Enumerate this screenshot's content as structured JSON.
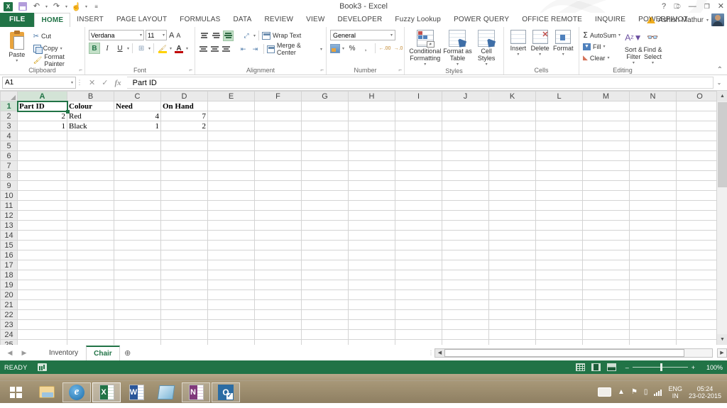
{
  "window": {
    "title": "Book3 - Excel",
    "help_icon": "?",
    "ribbon_display_icon": "ribbon-display-options",
    "minimize_icon": "—",
    "restore_icon": "❐",
    "close_icon": "✕"
  },
  "quick_access": {
    "items": [
      {
        "name": "excel-app-icon",
        "label": "X"
      },
      {
        "name": "save-icon",
        "label": ""
      },
      {
        "name": "undo-icon",
        "label": "↶"
      },
      {
        "name": "redo-icon",
        "label": "↷"
      },
      {
        "name": "touch-mode-icon",
        "label": "☝"
      },
      {
        "name": "customize-qat-icon",
        "label": "☰"
      }
    ]
  },
  "account": {
    "warning_icon": "warning-triangle-icon",
    "user_name": "Ashish Mathur",
    "dropdown": "▾"
  },
  "tabs": [
    {
      "label": "FILE",
      "active": false,
      "file": true
    },
    {
      "label": "HOME",
      "active": true
    },
    {
      "label": "INSERT",
      "active": false
    },
    {
      "label": "PAGE LAYOUT",
      "active": false
    },
    {
      "label": "FORMULAS",
      "active": false
    },
    {
      "label": "DATA",
      "active": false
    },
    {
      "label": "REVIEW",
      "active": false
    },
    {
      "label": "VIEW",
      "active": false
    },
    {
      "label": "DEVELOPER",
      "active": false
    },
    {
      "label": "Fuzzy Lookup",
      "active": false
    },
    {
      "label": "POWER QUERY",
      "active": false
    },
    {
      "label": "OFFICE REMOTE",
      "active": false
    },
    {
      "label": "INQUIRE",
      "active": false
    },
    {
      "label": "POWERPIVOT",
      "active": false
    }
  ],
  "ribbon": {
    "collapse_icon": "⌃",
    "clipboard": {
      "label": "Clipboard",
      "paste": "Paste",
      "cut": "Cut",
      "copy": "Copy",
      "format_painter": "Format Painter",
      "dialog_launcher": "⤵"
    },
    "font": {
      "label": "Font",
      "font_name": "Verdana",
      "font_size": "11",
      "grow_font": "A",
      "shrink_font": "A",
      "bold": "B",
      "italic": "I",
      "underline": "U",
      "borders": "⊞",
      "fill_color": "⬛",
      "font_color": "A",
      "dialog_launcher": "⤵"
    },
    "alignment": {
      "label": "Alignment",
      "wrap_text": "Wrap Text",
      "merge_center": "Merge & Center",
      "dialog_launcher": "⤵"
    },
    "number": {
      "label": "Number",
      "format": "General",
      "percent": "%",
      "comma": ",",
      "increase_decimal": ".00",
      "decrease_decimal": ".00",
      "dialog_launcher": "⤵"
    },
    "styles": {
      "label": "Styles",
      "conditional_formatting": "Conditional Formatting",
      "format_as_table": "Format as Table",
      "cell_styles": "Cell Styles"
    },
    "cells": {
      "label": "Cells",
      "insert": "Insert",
      "delete": "Delete",
      "format": "Format"
    },
    "editing": {
      "label": "Editing",
      "autosum": "AutoSum",
      "fill": "Fill",
      "clear": "Clear",
      "sort_filter": "Sort & Filter",
      "find_select": "Find & Select"
    }
  },
  "formula_bar": {
    "name_box": "A1",
    "name_box_caret": "▾",
    "cancel_icon": "✕",
    "enter_icon": "✓",
    "function_icon": "fx",
    "value": "Part ID",
    "expand_icon": "⌄"
  },
  "grid": {
    "columns": [
      "A",
      "B",
      "C",
      "D",
      "E",
      "F",
      "G",
      "H",
      "I",
      "J",
      "K",
      "L",
      "M",
      "N",
      "O"
    ],
    "rows": [
      1,
      2,
      3,
      4,
      5,
      6,
      7,
      8,
      9,
      10,
      11,
      12,
      13,
      14,
      15,
      16,
      17,
      18,
      19,
      20,
      21,
      22,
      23,
      24,
      25
    ],
    "selected_cell": "A1",
    "data": [
      {
        "row": 1,
        "cells": [
          {
            "col": "A",
            "value": "Part ID",
            "bold": true,
            "align": "left"
          },
          {
            "col": "B",
            "value": "Colour",
            "bold": true,
            "align": "left"
          },
          {
            "col": "C",
            "value": "Need",
            "bold": true,
            "align": "left"
          },
          {
            "col": "D",
            "value": "On Hand",
            "bold": true,
            "align": "left"
          }
        ]
      },
      {
        "row": 2,
        "cells": [
          {
            "col": "A",
            "value": "2",
            "bold": false,
            "align": "right"
          },
          {
            "col": "B",
            "value": "Red",
            "bold": false,
            "align": "left"
          },
          {
            "col": "C",
            "value": "4",
            "bold": false,
            "align": "right"
          },
          {
            "col": "D",
            "value": "7",
            "bold": false,
            "align": "right"
          }
        ]
      },
      {
        "row": 3,
        "cells": [
          {
            "col": "A",
            "value": "1",
            "bold": false,
            "align": "right"
          },
          {
            "col": "B",
            "value": "Black",
            "bold": false,
            "align": "left"
          },
          {
            "col": "C",
            "value": "1",
            "bold": false,
            "align": "right"
          },
          {
            "col": "D",
            "value": "2",
            "bold": false,
            "align": "right"
          }
        ]
      }
    ]
  },
  "sheet_tabs": {
    "first_icon": "◀",
    "last_icon": "▶",
    "sheets": [
      {
        "label": "Inventory",
        "active": false
      },
      {
        "label": "Chair",
        "active": true
      }
    ],
    "add_sheet": "⊕"
  },
  "status_bar": {
    "state": "READY",
    "macro_icon": "record-macro-icon",
    "views": [
      {
        "name": "normal-view-button"
      },
      {
        "name": "page-layout-view-button"
      },
      {
        "name": "page-break-preview-button"
      }
    ],
    "zoom_out": "–",
    "zoom_in": "+",
    "zoom_level": "100%"
  },
  "taskbar": {
    "start": "start-button",
    "items": [
      {
        "name": "file-explorer-icon",
        "label": ""
      },
      {
        "name": "internet-explorer-icon",
        "label": "e"
      },
      {
        "name": "excel-taskbar-icon",
        "label": "X",
        "active": true
      },
      {
        "name": "word-taskbar-icon",
        "label": "W"
      },
      {
        "name": "sticky-notes-icon",
        "label": ""
      },
      {
        "name": "onenote-taskbar-icon",
        "label": "N"
      },
      {
        "name": "outlook-taskbar-icon",
        "label": "O"
      }
    ],
    "tray": {
      "keyboard_icon": "keyboard-icon",
      "show_hidden_icon": "▲",
      "flag_icon": "⚑",
      "battery_icon": "▯",
      "signal_icon": "signal-bars-icon",
      "language_line1": "ENG",
      "language_line2": "IN",
      "time": "05:24",
      "date": "23-02-2015"
    }
  },
  "colors": {
    "excel_green": "#217346",
    "selection_green": "#217346",
    "header_gray": "#eaeaea"
  }
}
